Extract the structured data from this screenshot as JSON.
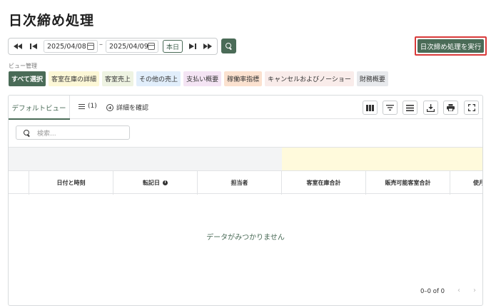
{
  "page": {
    "title": "日次締め処理"
  },
  "date_range": {
    "start": "2025/04/08",
    "separator": "–",
    "end": "2025/04/09",
    "today_label": "本日"
  },
  "actions": {
    "execute_label": "日次締め処理を実行"
  },
  "views": {
    "label": "ビュー管理",
    "chips": [
      {
        "label": "すべて選択",
        "bg": "#4a6b57",
        "color": "#ffffff"
      },
      {
        "label": "客室在庫の詳細",
        "bg": "#fcf7d6",
        "color": "#333333"
      },
      {
        "label": "客室売上",
        "bg": "#eef3e2",
        "color": "#333333"
      },
      {
        "label": "その他の売上",
        "bg": "#e1eefb",
        "color": "#333333"
      },
      {
        "label": "支払い概要",
        "bg": "#f4e4f4",
        "color": "#333333"
      },
      {
        "label": "稼働率指標",
        "bg": "#fbe1cf",
        "color": "#333333"
      },
      {
        "label": "キャンセルおよびノーショー",
        "bg": "#f9ecea",
        "color": "#333333"
      },
      {
        "label": "財務概要",
        "bg": "#e7e9ec",
        "color": "#333333"
      }
    ]
  },
  "tabs": {
    "default_view": "デフォルトビュー",
    "count_label": "(1)",
    "detail_label": "詳細を確認"
  },
  "search": {
    "placeholder": "検索..."
  },
  "table": {
    "columns": [
      "日付と時刻",
      "転記日",
      "担当者",
      "客室在庫合計",
      "販売可能客室合計",
      "使月"
    ],
    "info_glyph": "i",
    "empty_message": "データがみつかりません"
  },
  "pagination": {
    "range": "0–0 of 0"
  },
  "colors": {
    "accent": "#4a6b57",
    "highlight": "#d93a3a",
    "group_yellow": "#fffadc"
  }
}
